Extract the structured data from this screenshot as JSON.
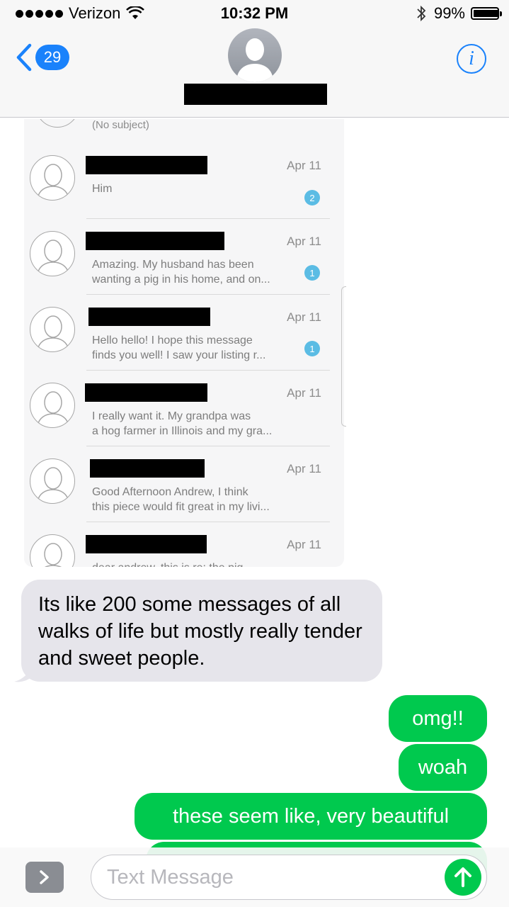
{
  "status_bar": {
    "carrier": "Verizon",
    "time": "10:32 PM",
    "battery_percent_text": "99%",
    "battery_level": 0.99
  },
  "header": {
    "back_count": "29",
    "info_icon": "info-icon"
  },
  "screenshot": {
    "top_subject": "(No subject)",
    "rows": [
      {
        "date": "Apr 11",
        "preview": [
          "Him"
        ],
        "badge": "2"
      },
      {
        "date": "Apr 11",
        "preview": [
          "Amazing. My husband has been",
          "wanting a pig in his home, and on..."
        ],
        "badge": "1"
      },
      {
        "date": "Apr 11",
        "preview": [
          "Hello hello! I hope this message",
          "finds you well! I saw your listing r..."
        ],
        "badge": "1"
      },
      {
        "date": "Apr 11",
        "preview": [
          "I really want it. My grandpa was",
          "a hog farmer in Illinois and my gra..."
        ],
        "badge": ""
      },
      {
        "date": "Apr 11",
        "preview": [
          "Good Afternoon Andrew, I think",
          "this piece would fit great in my livi..."
        ],
        "badge": ""
      },
      {
        "date": "Apr 11",
        "preview": [
          "dear andrew,  this is re: the pig"
        ],
        "badge": ""
      }
    ]
  },
  "messages": {
    "received_1": "Its like 200 some messages of all walks of life but mostly really tender and sweet people.",
    "sent_1": "omg!!",
    "sent_2": "woah",
    "sent_3": "these seem like, very beautiful",
    "sent_4": ""
  },
  "input": {
    "placeholder": "Text Message"
  },
  "colors": {
    "ios_blue": "#1a82fb",
    "sent_green": "#00c94e",
    "received_gray": "#e6e5eb",
    "badge_blue": "#5bbce4"
  }
}
